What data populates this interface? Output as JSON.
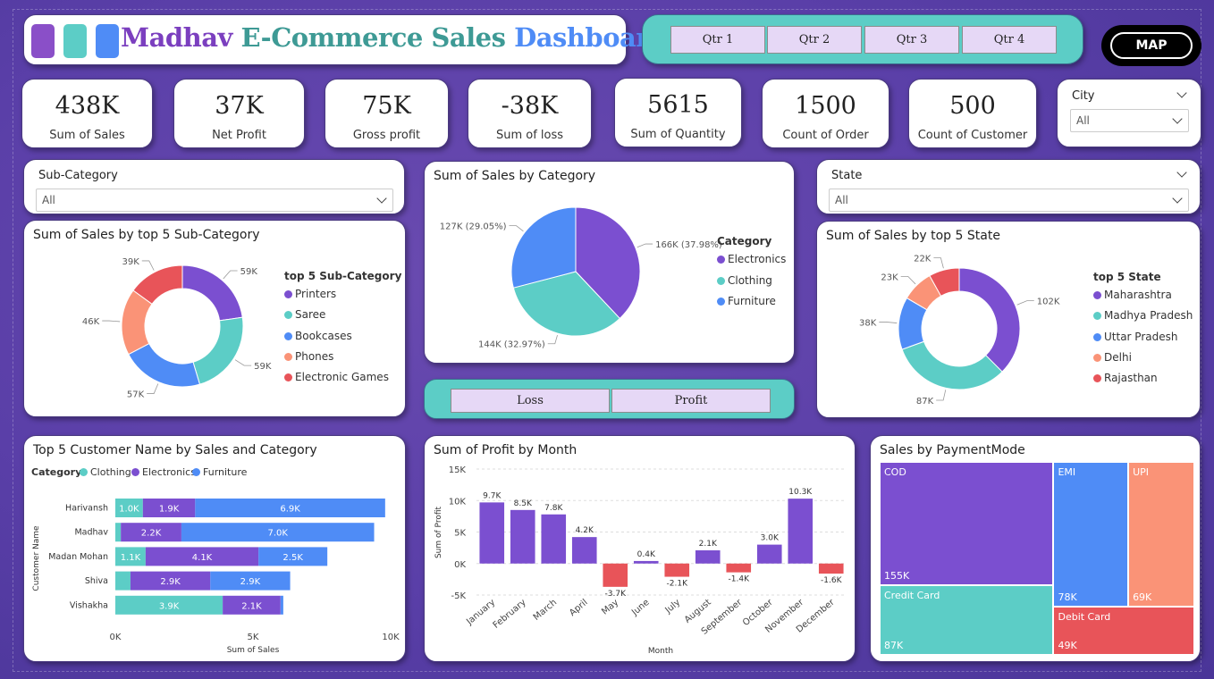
{
  "header": {
    "title_part1": "Madhav",
    "title_part2": "E-Commerce Sales",
    "title_part3": "Dashboard",
    "square_colors": [
      "#8a4fc8",
      "#5ccdc6",
      "#4f8cf6"
    ]
  },
  "quarters": [
    "Qtr 1",
    "Qtr 2",
    "Qtr 3",
    "Qtr 4"
  ],
  "map_button": "MAP",
  "kpis": [
    {
      "value": "438K",
      "label": "Sum of Sales"
    },
    {
      "value": "37K",
      "label": "Net Profit"
    },
    {
      "value": "75K",
      "label": "Gross profit"
    },
    {
      "value": "-38K",
      "label": "Sum of loss"
    },
    {
      "value": "5615",
      "label": "Sum of Quantity"
    },
    {
      "value": "1500",
      "label": "Count of Order"
    },
    {
      "value": "500",
      "label": "Count of Customer"
    }
  ],
  "slicers": {
    "city": {
      "label": "City",
      "value": "All"
    },
    "subcategory": {
      "label": "Sub-Category",
      "value": "All"
    },
    "state": {
      "label": "State",
      "value": "All"
    }
  },
  "colors": {
    "purple": "#7b4fd0",
    "teal": "#5ccdc6",
    "blue": "#4f8cf6",
    "salmon": "#fa9377",
    "red": "#e85459"
  },
  "toggle": {
    "loss": "Loss",
    "profit": "Profit"
  },
  "chart_data": [
    {
      "id": "subcat",
      "type": "pie",
      "donut": true,
      "title": "Sum of Sales by top 5 Sub-Category",
      "legend_title": "top 5 Sub-Category",
      "legend_position": "right",
      "categories": [
        "Printers",
        "Saree",
        "Bookcases",
        "Phones",
        "Electronic Games"
      ],
      "values": [
        59,
        59,
        57,
        46,
        39
      ],
      "labels": [
        "59K",
        "59K",
        "57K",
        "46K",
        "39K"
      ]
    },
    {
      "id": "category",
      "type": "pie",
      "title": "Sum of Sales by Category",
      "legend_title": "Category",
      "legend_position": "right",
      "categories": [
        "Electronics",
        "Clothing",
        "Furniture"
      ],
      "values": [
        166,
        144,
        127
      ],
      "labels": [
        "166K (37.98%)",
        "144K (32.97%)",
        "127K (29.05%)"
      ]
    },
    {
      "id": "state",
      "type": "pie",
      "donut": true,
      "title": "Sum of Sales by top 5 State",
      "legend_title": "top 5 State",
      "legend_position": "right",
      "categories": [
        "Maharashtra",
        "Madhya Pradesh",
        "Uttar Pradesh",
        "Delhi",
        "Rajasthan"
      ],
      "values": [
        102,
        87,
        38,
        23,
        22
      ],
      "labels": [
        "102K",
        "87K",
        "38K",
        "23K",
        "22K"
      ]
    },
    {
      "id": "customer",
      "type": "bar",
      "orientation": "horizontal",
      "stacked": true,
      "title": "Top 5 Customer Name by Sales and Category",
      "legend_title": "Category",
      "legend_position": "top-left",
      "xlabel": "Sum of Sales",
      "ylabel": "Customer Name",
      "xlim": [
        0,
        10000
      ],
      "xticks": [
        "0K",
        "5K",
        "10K"
      ],
      "categories": [
        "Harivansh",
        "Madhav",
        "Madan Mohan",
        "Shiva",
        "Vishakha"
      ],
      "series": [
        {
          "name": "Clothing",
          "values": [
            1000,
            200,
            1100,
            550,
            3900
          ],
          "labels": [
            "1.0K",
            "",
            "1.1K",
            "",
            "3.9K"
          ]
        },
        {
          "name": "Electronics",
          "values": [
            1900,
            2200,
            4100,
            2900,
            2100
          ],
          "labels": [
            "1.9K",
            "2.2K",
            "4.1K",
            "2.9K",
            "2.1K"
          ]
        },
        {
          "name": "Furniture",
          "values": [
            6900,
            7000,
            2500,
            2900,
            100
          ],
          "labels": [
            "6.9K",
            "7.0K",
            "2.5K",
            "2.9K",
            ""
          ]
        }
      ]
    },
    {
      "id": "profit",
      "type": "bar",
      "title": "Sum of Profit by Month",
      "xlabel": "Month",
      "ylabel": "Sum of Profit",
      "ylim": [
        -5000,
        15000
      ],
      "yticks": [
        "-5K",
        "0K",
        "5K",
        "10K",
        "15K"
      ],
      "grid": true,
      "categories": [
        "January",
        "February",
        "March",
        "April",
        "May",
        "June",
        "July",
        "August",
        "September",
        "October",
        "November",
        "December"
      ],
      "values": [
        9700,
        8500,
        7800,
        4200,
        -3700,
        400,
        -2100,
        2100,
        -1400,
        3000,
        10300,
        -1600
      ],
      "labels": [
        "9.7K",
        "8.5K",
        "7.8K",
        "4.2K",
        "-3.7K",
        "0.4K",
        "-2.1K",
        "2.1K",
        "-1.4K",
        "3.0K",
        "10.3K",
        "-1.6K"
      ]
    },
    {
      "id": "payment",
      "type": "treemap",
      "title": "Sales by PaymentMode",
      "categories": [
        "COD",
        "Credit Card",
        "EMI",
        "UPI",
        "Debit Card"
      ],
      "values": [
        155,
        87,
        78,
        69,
        49
      ],
      "labels": [
        "155K",
        "87K",
        "78K",
        "69K",
        "49K"
      ]
    }
  ]
}
